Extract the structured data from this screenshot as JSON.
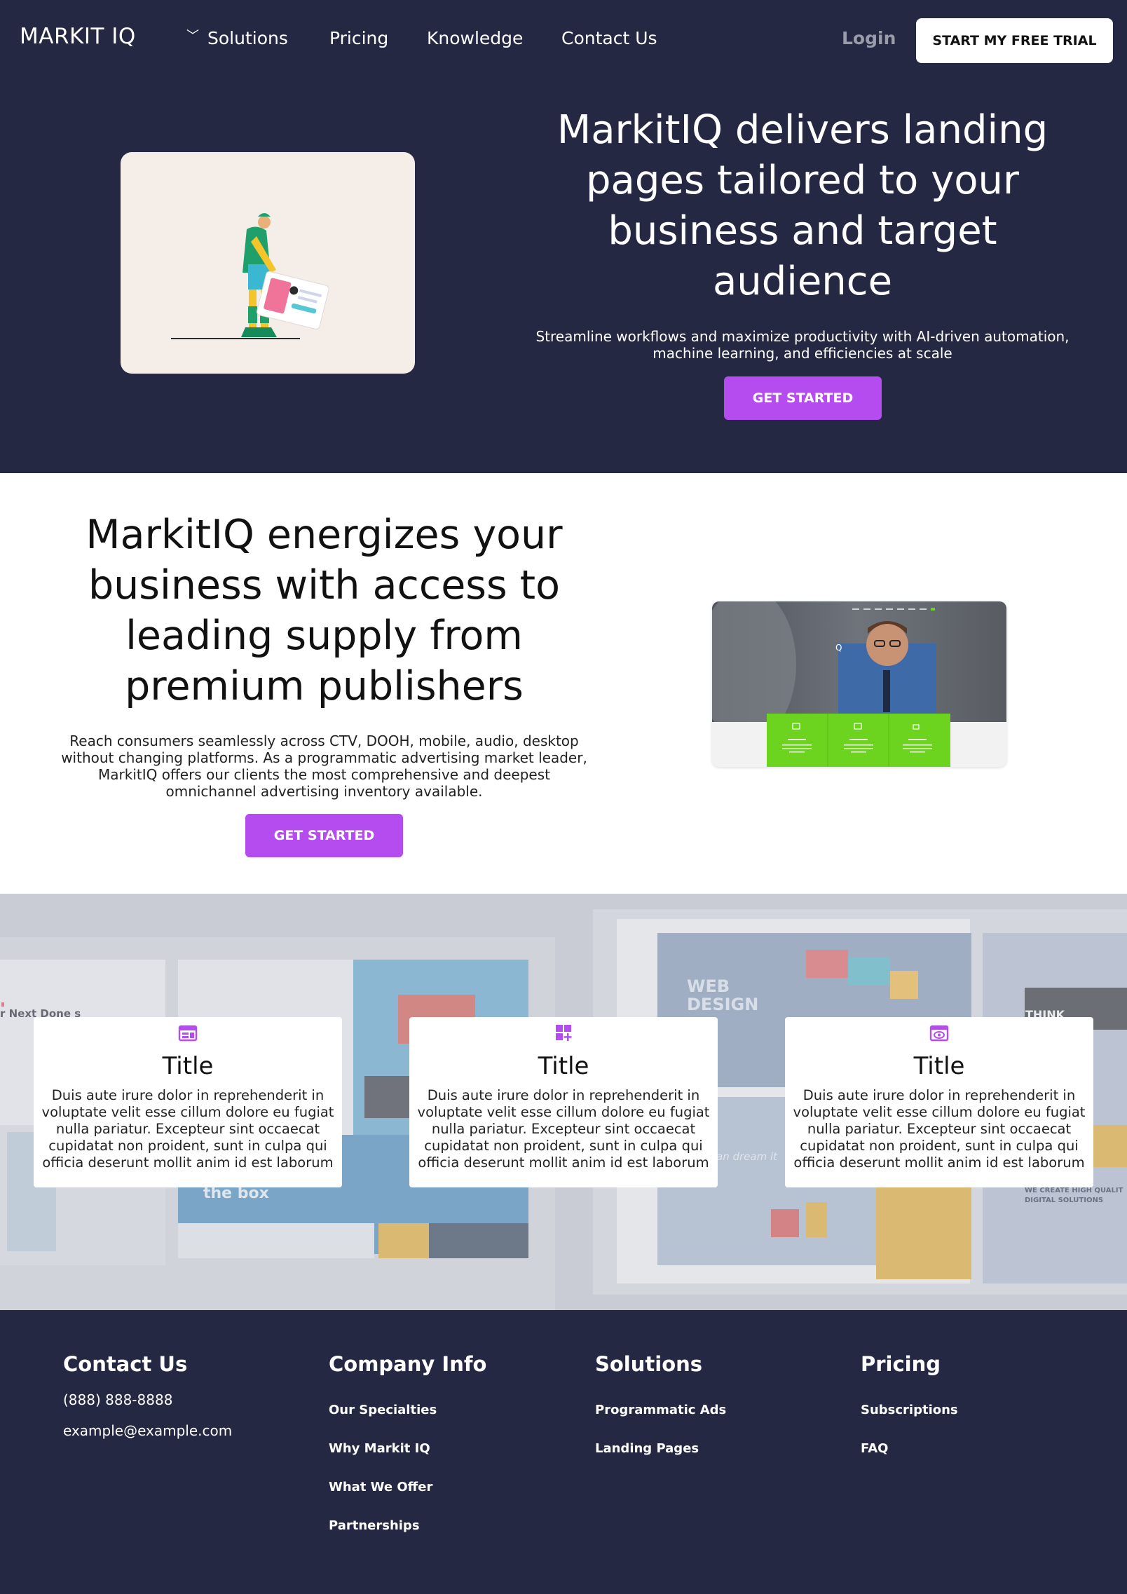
{
  "nav": {
    "brand": "MARKIT IQ",
    "links": [
      "Solutions",
      "Pricing",
      "Knowledge",
      "Contact Us"
    ],
    "login": "Login",
    "cta": "START MY FREE TRIAL"
  },
  "hero": {
    "title": "MarkitIQ delivers landing pages tailored to your business and target audience",
    "subtitle": "Streamline workflows and maximize productivity with AI-driven automation, machine learning, and efficiencies at scale",
    "cta": "GET STARTED"
  },
  "supply": {
    "title": "MarkitIQ energizes your business with access to leading supply from premium publishers",
    "text": "Reach consumers seamlessly across CTV, DOOH, mobile, audio, desktop without changing platforms. As a programmatic advertising market leader, MarkitIQ offers our clients the most comprehensive and deepest omnichannel advertising inventory available.",
    "cta": "GET STARTED"
  },
  "features": [
    {
      "icon": "browser-layout-icon",
      "title": "Title",
      "text": "Duis aute irure dolor in reprehenderit in voluptate velit esse cillum dolore eu fugiat nulla pariatur. Excepteur sint occaecat cupidatat non proident, sunt in culpa qui officia deserunt mollit anim id est laborum"
    },
    {
      "icon": "grid-add-icon",
      "title": "Title",
      "text": "Duis aute irure dolor in reprehenderit in voluptate velit esse cillum dolore eu fugiat nulla pariatur. Excepteur sint occaecat cupidatat non proident, sunt in culpa qui officia deserunt mollit anim id est laborum"
    },
    {
      "icon": "browser-eye-icon",
      "title": "Title",
      "text": "Duis aute irure dolor in reprehenderit in voluptate velit esse cillum dolore eu fugiat nulla pariatur. Excepteur sint occaecat cupidatat non proident, sunt in culpa qui officia deserunt mollit anim id est laborum"
    }
  ],
  "background_mockups": {
    "left_headline": "r Next\nDone\ns",
    "left_footer_text": "the box",
    "web_design_label": "WEB\nDESIGN",
    "dream_text": "an dream it\nn do it.",
    "think_label": "THINK",
    "we_create_label": "WE CREATE HIGH QUALIT\nDIGITAL SOLUTIONS"
  },
  "footer": {
    "contact": {
      "heading": "Contact Us",
      "phone": "(888) 888-8888",
      "email": "example@example.com"
    },
    "company": {
      "heading": "Company Info",
      "links": [
        "Our Specialties",
        "Why Markit IQ",
        "What We Offer",
        "Partnerships"
      ]
    },
    "solutions": {
      "heading": "Solutions",
      "links": [
        "Programmatic Ads",
        "Landing Pages"
      ]
    },
    "pricing": {
      "heading": "Pricing",
      "links": [
        "Subscriptions",
        "FAQ"
      ]
    }
  },
  "colors": {
    "navy": "#252842",
    "accent_purple": "#b54cf0",
    "green": "#6cd41f"
  }
}
